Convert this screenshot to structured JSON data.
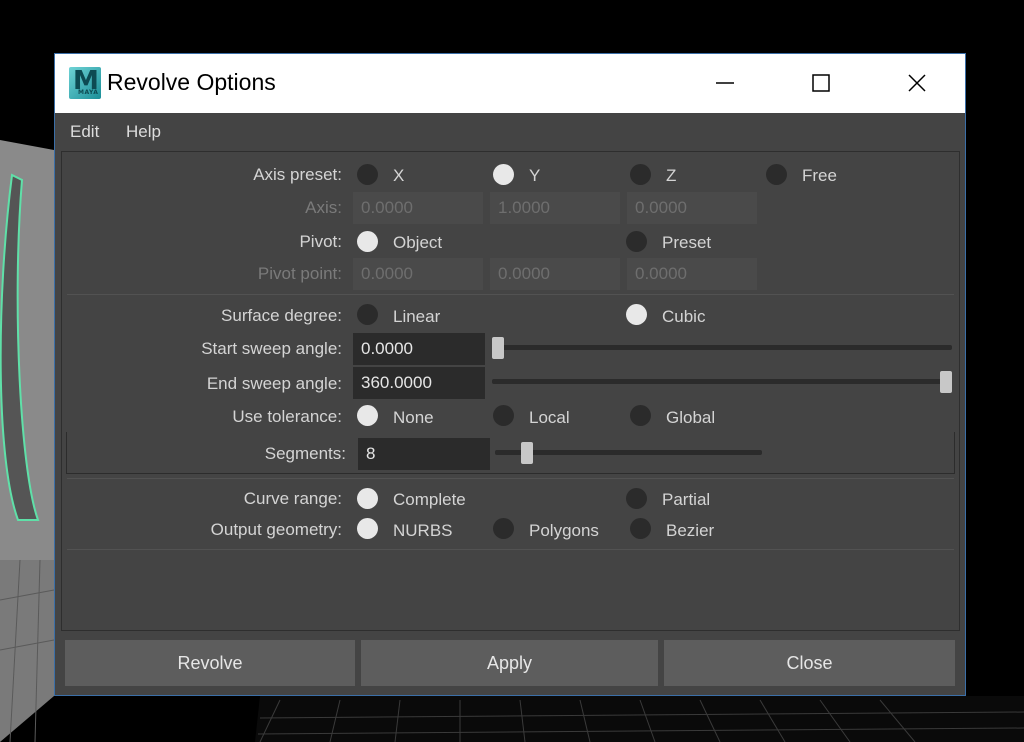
{
  "window": {
    "title": "Revolve Options",
    "logo_letter": "M",
    "logo_sub": "MAYA"
  },
  "menu": {
    "items": [
      "Edit",
      "Help"
    ]
  },
  "axis_preset": {
    "label": "Axis preset:",
    "options": [
      "X",
      "Y",
      "Z",
      "Free"
    ],
    "selected": "Y"
  },
  "axis": {
    "label": "Axis:",
    "values": [
      "0.0000",
      "1.0000",
      "0.0000"
    ]
  },
  "pivot": {
    "label": "Pivot:",
    "options": [
      "Object",
      "Preset"
    ],
    "selected": "Object"
  },
  "pivot_point": {
    "label": "Pivot point:",
    "values": [
      "0.0000",
      "0.0000",
      "0.0000"
    ]
  },
  "surface_degree": {
    "label": "Surface degree:",
    "options": [
      "Linear",
      "Cubic"
    ],
    "selected": "Cubic"
  },
  "start_sweep": {
    "label": "Start sweep angle:",
    "value": "0.0000",
    "fraction": 0.0
  },
  "end_sweep": {
    "label": "End sweep angle:",
    "value": "360.0000",
    "fraction": 1.0
  },
  "use_tolerance": {
    "label": "Use tolerance:",
    "options": [
      "None",
      "Local",
      "Global"
    ],
    "selected": "None"
  },
  "segments": {
    "label": "Segments:",
    "value": "8",
    "fraction": 0.1
  },
  "curve_range": {
    "label": "Curve range:",
    "options": [
      "Complete",
      "Partial"
    ],
    "selected": "Complete"
  },
  "output_geometry": {
    "label": "Output geometry:",
    "options": [
      "NURBS",
      "Polygons",
      "Bezier"
    ],
    "selected": "NURBS"
  },
  "buttons": {
    "revolve": "Revolve",
    "apply": "Apply",
    "close": "Close"
  }
}
